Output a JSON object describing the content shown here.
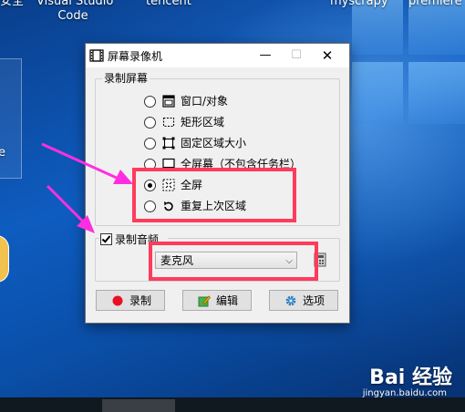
{
  "desktop": {
    "icons": [
      {
        "label": "安全",
        "name": "desktop-icon-left-top"
      },
      {
        "label": "Visual Studio\nCode",
        "name": "desktop-icon-vscode"
      },
      {
        "label": "tencent",
        "name": "desktop-icon-tencent"
      },
      {
        "label": "myscrapy",
        "name": "desktop-icon-myscrapy"
      },
      {
        "label": "premiere",
        "name": "desktop-icon-premiere"
      },
      {
        "label": "e",
        "name": "desktop-icon-edge-partial"
      }
    ],
    "watermark": "Bai 经验",
    "watermark_url": "jingyan.baidu.com"
  },
  "window": {
    "title": "屏幕录像机",
    "buttons": {
      "minimize": "—",
      "maximize": "☐",
      "close": "✕"
    },
    "record_screen": {
      "legend": "录制屏幕",
      "options": [
        {
          "label": "窗口/对象",
          "checked": false,
          "icon": "window-icon"
        },
        {
          "label": "矩形区域",
          "checked": false,
          "icon": "rectangle-selection-icon"
        },
        {
          "label": "固定区域大小",
          "checked": false,
          "icon": "fixed-region-icon"
        },
        {
          "label": "全屏幕（不包含任务栏）",
          "checked": false,
          "icon": "fullscreen-no-taskbar-icon"
        },
        {
          "label": "全屏",
          "checked": true,
          "icon": "fullscreen-icon"
        },
        {
          "label": "重复上次区域",
          "checked": false,
          "icon": "repeat-region-icon"
        }
      ]
    },
    "record_audio": {
      "label": "录制音频",
      "checked": true,
      "device": "麦克风"
    },
    "actions": {
      "record": "录制",
      "edit": "编辑",
      "options": "选项"
    }
  },
  "colors": {
    "annotation": "#ff3b5c",
    "arrow": "#ff2fe0",
    "record_dot": "#e81123"
  }
}
